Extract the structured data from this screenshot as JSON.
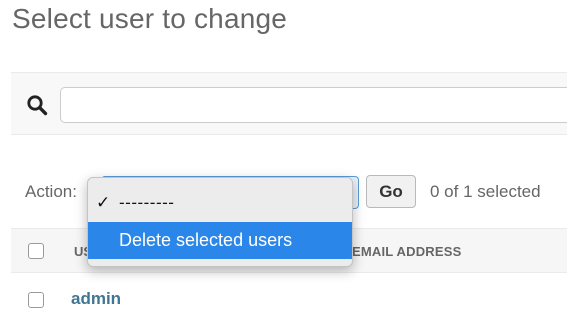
{
  "page": {
    "title": "Select user to change"
  },
  "search": {
    "icon": "search-icon",
    "value": "",
    "placeholder": ""
  },
  "actions": {
    "label": "Action:",
    "go_label": "Go",
    "selected_count": "0 of 1 selected",
    "dropdown": {
      "open": true,
      "options": [
        {
          "label": "---------",
          "checked": true,
          "highlighted": false
        },
        {
          "label": "Delete selected users",
          "checked": false,
          "highlighted": true
        }
      ],
      "highlight_color": "#2a86e8"
    }
  },
  "table": {
    "columns": [
      "USERNAME",
      "EMAIL ADDRESS"
    ],
    "rows": [
      {
        "username": "admin",
        "email": ""
      }
    ],
    "link_color": "#417690"
  }
}
